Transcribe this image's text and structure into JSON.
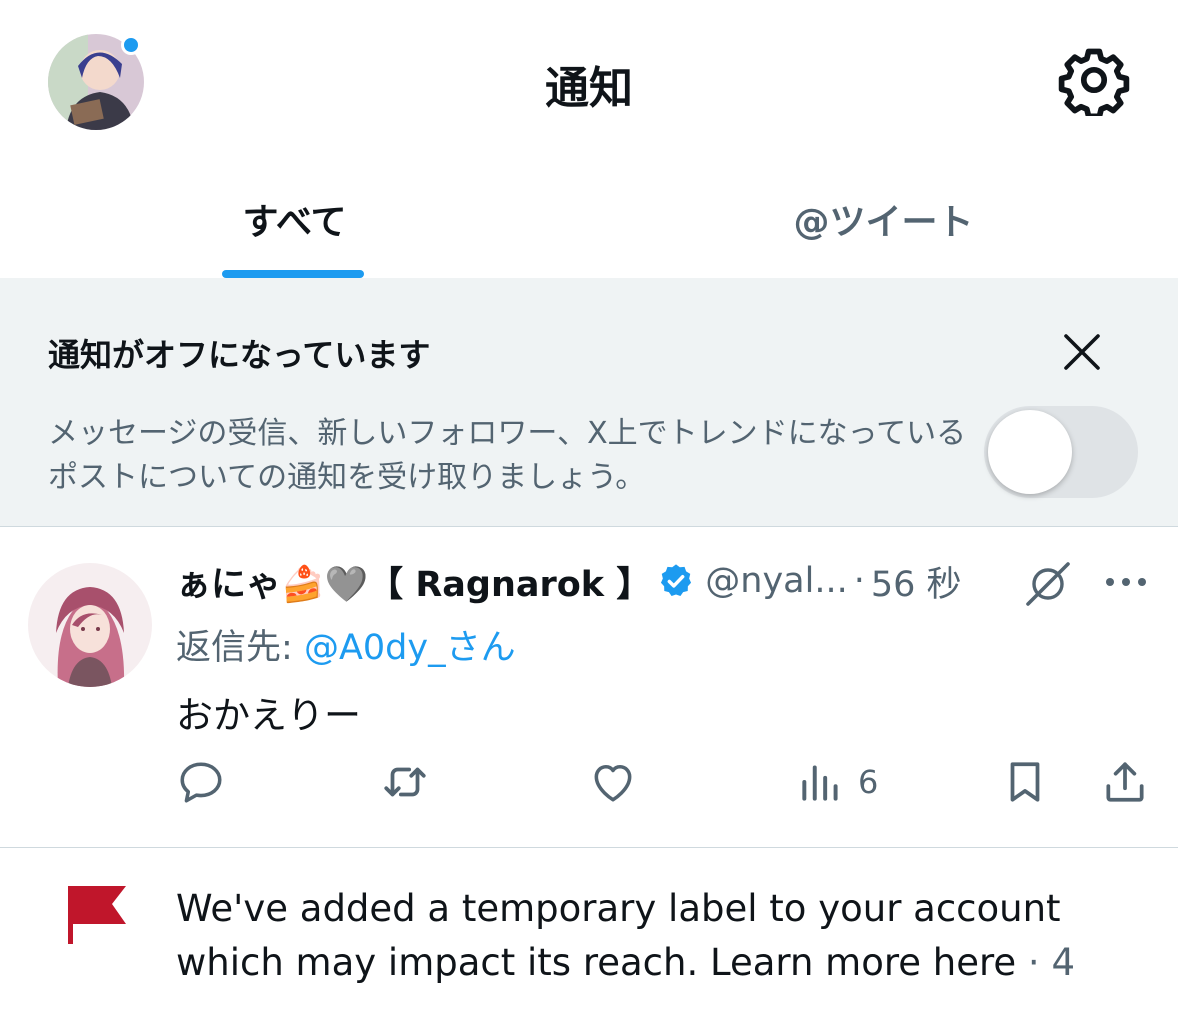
{
  "header": {
    "title": "通知",
    "avatar_icon": "user-avatar-icon",
    "settings_icon": "gear-icon"
  },
  "tabs": [
    {
      "label": "すべて",
      "active": true
    },
    {
      "label": "@ツイート",
      "active": false
    }
  ],
  "banner": {
    "title": "通知がオフになっています",
    "text": "メッセージの受信、新しいフォロワー、X上でトレンドになっているポストについての通知を受け取りましょう。",
    "toggle_on": false
  },
  "tweet": {
    "display_name": "ぁにゃ🍰🩶【 Ragnarok 】",
    "handle": "@nyal...",
    "separator": "·",
    "time": "56 秒",
    "reply_prefix": "返信先:",
    "reply_to": "@A0dy_さん",
    "body": "おかえりー",
    "views": "6"
  },
  "notice": {
    "text": "We've added a temporary label to your account which may impact its reach. Learn more here",
    "meta": "· 4"
  },
  "colors": {
    "accent": "#1d9bf0",
    "banner_bg": "#eff3f4",
    "secondary_text": "#536471",
    "flag": "#c0162b"
  }
}
